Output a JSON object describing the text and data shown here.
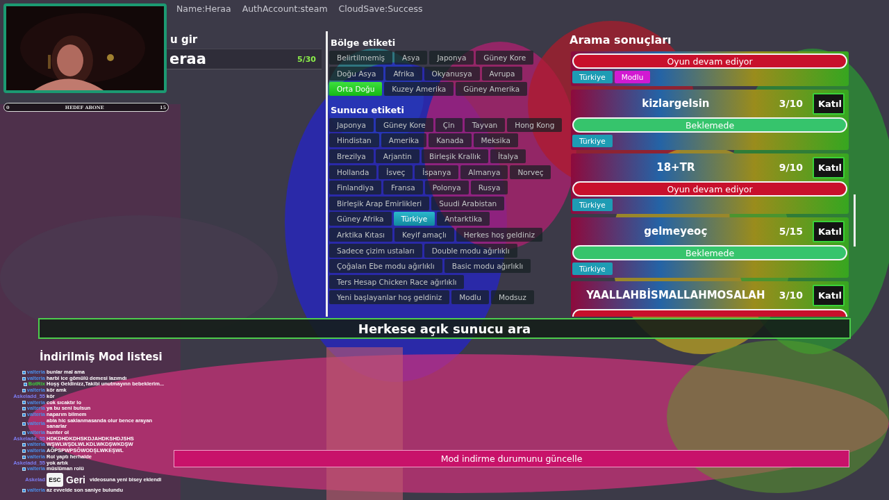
{
  "header": {
    "player_name": "Name:Heraa",
    "auth_account": "AuthAccount:steam",
    "cloud_save": "CloudSave:Success"
  },
  "goal_bar": {
    "min": "0",
    "label": "HEDEF ABONE",
    "max": "15"
  },
  "name_entry": {
    "label": "u gir",
    "value": "eraa",
    "counter": "5/30"
  },
  "region_tags": {
    "title": "Bölge etiketi",
    "rows": [
      {
        "tags": [
          {
            "label": "Belirtilmemiş",
            "selected": false
          },
          {
            "label": "Asya",
            "selected": false
          },
          {
            "label": "Japonya",
            "selected": false
          },
          {
            "label": "Güney Kore",
            "selected": false
          }
        ]
      },
      {
        "tags": [
          {
            "label": "Doğu Asya",
            "selected": false
          },
          {
            "label": "Afrika",
            "selected": false
          },
          {
            "label": "Okyanusya",
            "selected": false
          },
          {
            "label": "Avrupa",
            "selected": false
          }
        ]
      },
      {
        "tags": [
          {
            "label": "Orta Doğu",
            "selected": true
          },
          {
            "label": "Kuzey Amerika",
            "selected": false
          },
          {
            "label": "Güney Amerika",
            "selected": false
          }
        ]
      }
    ]
  },
  "server_tags": {
    "title": "Sunucu etiketi",
    "rows": [
      {
        "tags": [
          {
            "label": "Japonya",
            "selected": false
          },
          {
            "label": "Güney Kore",
            "selected": false
          },
          {
            "label": "Çin",
            "selected": false
          },
          {
            "label": "Tayvan",
            "selected": false
          },
          {
            "label": "Hong Kong",
            "selected": false
          }
        ]
      },
      {
        "tags": [
          {
            "label": "Hindistan",
            "selected": false
          },
          {
            "label": "Amerika",
            "selected": false
          },
          {
            "label": "Kanada",
            "selected": false
          },
          {
            "label": "Meksika",
            "selected": false
          }
        ]
      },
      {
        "tags": [
          {
            "label": "Brezilya",
            "selected": false
          },
          {
            "label": "Arjantin",
            "selected": false
          },
          {
            "label": "Birleşik Krallık",
            "selected": false
          },
          {
            "label": "İtalya",
            "selected": false
          }
        ]
      },
      {
        "tags": [
          {
            "label": "Hollanda",
            "selected": false
          },
          {
            "label": "İsveç",
            "selected": false
          },
          {
            "label": "İspanya",
            "selected": false
          },
          {
            "label": "Almanya",
            "selected": false
          },
          {
            "label": "Norveç",
            "selected": false
          }
        ]
      },
      {
        "tags": [
          {
            "label": "Finlandiya",
            "selected": false
          },
          {
            "label": "Fransa",
            "selected": false
          },
          {
            "label": "Polonya",
            "selected": false
          },
          {
            "label": "Rusya",
            "selected": false
          }
        ]
      },
      {
        "tags": [
          {
            "label": "Birleşik Arap Emirlikleri",
            "selected": false
          },
          {
            "label": "Suudi Arabistan",
            "selected": false
          }
        ]
      },
      {
        "tags": [
          {
            "label": "Güney Afrika",
            "selected": false
          },
          {
            "label": "Türkiye",
            "selected": true
          },
          {
            "label": "Antarktika",
            "selected": false
          }
        ]
      },
      {
        "tags": [
          {
            "label": "Arktika Kıtası",
            "selected": false
          },
          {
            "label": "Keyif amaçlı",
            "selected": false
          },
          {
            "label": "Herkes hoş geldiniz",
            "selected": false
          }
        ]
      },
      {
        "tags": [
          {
            "label": "Sadece çizim ustaları",
            "selected": false
          },
          {
            "label": "Double modu ağırlıklı",
            "selected": false
          }
        ]
      },
      {
        "tags": [
          {
            "label": "Çoğalan Ebe modu ağırlıklı",
            "selected": false
          },
          {
            "label": "Basic modu ağırlıklı",
            "selected": false
          }
        ]
      },
      {
        "tags": [
          {
            "label": "Ters Hesap Chicken Race ağırlıklı",
            "selected": false
          }
        ]
      },
      {
        "tags": [
          {
            "label": "Yeni başlayanlar hoş geldiniz",
            "selected": false
          },
          {
            "label": "Modlu",
            "selected": false
          },
          {
            "label": "Modsuz",
            "selected": false
          }
        ]
      }
    ]
  },
  "results": {
    "title": "Arama sonuçları",
    "cards": [
      {
        "status": {
          "kind": "playing",
          "label": "Oyun devam ediyor"
        },
        "tags": [
          {
            "label": "Türkiye",
            "color": "#1e9cb4"
          },
          {
            "label": "Modlu",
            "color": "#d21ad2"
          }
        ]
      },
      {
        "name": "kizlargelsin",
        "count": "3/10",
        "join": "Katıl",
        "status": {
          "kind": "waiting",
          "label": "Beklemede"
        },
        "tags": [
          {
            "label": "Türkiye",
            "color": "#1e9cb4"
          }
        ]
      },
      {
        "name": "18+TR",
        "count": "9/10",
        "join": "Katıl",
        "status": {
          "kind": "playing",
          "label": "Oyun devam ediyor"
        },
        "tags": [
          {
            "label": "Türkiye",
            "color": "#1e9cb4"
          }
        ]
      },
      {
        "name": "gelmeyeoç",
        "count": "5/15",
        "join": "Katıl",
        "status": {
          "kind": "waiting",
          "label": "Beklemede"
        },
        "tags": [
          {
            "label": "Türkiye",
            "color": "#1e9cb4"
          }
        ]
      },
      {
        "name": "YAALLAHBİSMALLAHMOSALAH",
        "count": "3/10",
        "join": "Katıl",
        "status": {
          "kind": "playing"
        }
      }
    ]
  },
  "search_button": "Herkese açık sunucu ara",
  "mod_list": {
    "title": "İndirilmiş Mod listesi",
    "update_button": "Mod indirme durumunu güncelle"
  },
  "back_button": {
    "key": "ESC",
    "label": "Geri"
  },
  "chat": [
    {
      "user": "valteria",
      "color": "#4a8ee8",
      "badge": true,
      "text": "bunlar mal ama"
    },
    {
      "user": "valteria",
      "color": "#4a8ee8",
      "badge": true,
      "text": "harbi ice gömülü demesi lazımdı"
    },
    {
      "user": "BotRix",
      "color": "#3ccc3c",
      "badge": true,
      "text": "Hoşş Geldinizz,Takibi unutmayınn bebeklerim..."
    },
    {
      "user": "valteria",
      "color": "#4a8ee8",
      "badge": true,
      "text": "kör amk"
    },
    {
      "user": "Askeladd_55",
      "color": "#7c7cf0",
      "badge": false,
      "text": "kör"
    },
    {
      "user": "valteria",
      "color": "#4a8ee8",
      "badge": true,
      "text": "cok sıcaktır lo"
    },
    {
      "user": "valteria",
      "color": "#4a8ee8",
      "badge": true,
      "text": "ya bu seni bulsun"
    },
    {
      "user": "valteria",
      "color": "#4a8ee8",
      "badge": true,
      "text": "naparım bilmem"
    },
    {
      "user": "valteria",
      "color": "#4a8ee8",
      "badge": true,
      "text": "abla hic saklanmasanda olur bence arayan sanarlar"
    },
    {
      "user": "valteria",
      "color": "#4a8ee8",
      "badge": true,
      "text": "hunter ol"
    },
    {
      "user": "Askeladd_55",
      "color": "#7c7cf0",
      "badge": false,
      "text": "HDKDHDKDHSKDJAHDKSHDJSHS"
    },
    {
      "user": "valteria",
      "color": "#4a8ee8",
      "badge": true,
      "text": "WŞWLWŞDLWLKDLWKDŞWKDŞW"
    },
    {
      "user": "valteria",
      "color": "#4a8ee8",
      "badge": true,
      "text": "AÖPSPWPSÖWODŞLWKEŞWL"
    },
    {
      "user": "valteria",
      "color": "#4a8ee8",
      "badge": true,
      "text": "Rol yaptı herhalde"
    },
    {
      "user": "Askeladd_55",
      "color": "#7c7cf0",
      "badge": false,
      "text": "yok artık"
    },
    {
      "user": "valteria",
      "color": "#4a8ee8",
      "badge": true,
      "text": "müslüman rolü"
    },
    {
      "user": "Askelad",
      "color": "#7c7cf0",
      "badge": false,
      "text": "videosuna yeni bisey eklendi",
      "back": true
    },
    {
      "user": "valteria",
      "color": "#4a8ee8",
      "badge": true,
      "text": "az evvelde son saniye bulundu"
    }
  ]
}
